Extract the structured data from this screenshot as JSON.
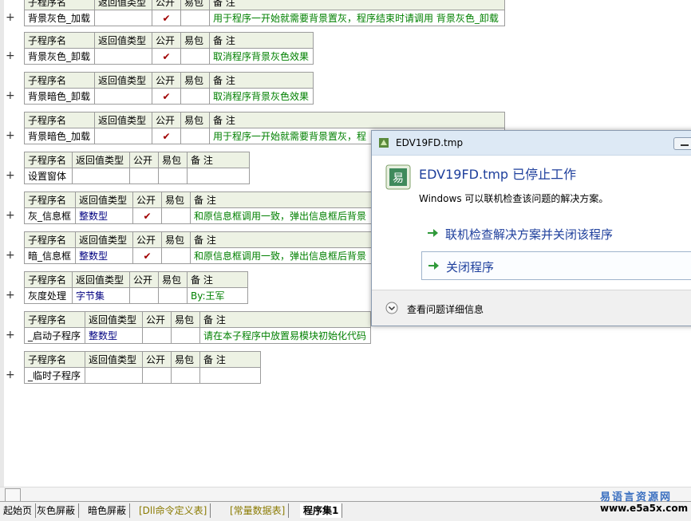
{
  "headers": {
    "name": "子程序名",
    "ret": "返回值类型",
    "pub": "公开",
    "easy": "易包",
    "note": "备 注"
  },
  "checkmark": "✔",
  "plus": "+",
  "subs": [
    {
      "name": "背景灰色_加载",
      "ret": "",
      "pub": "✔",
      "note": "用于程序一开始就需要背景置灰，程序结束时请调用 背景灰色_卸载"
    },
    {
      "name": "背景灰色_卸载",
      "ret": "",
      "pub": "✔",
      "note": "取消程序背景灰色效果"
    },
    {
      "name": "背景暗色_卸载",
      "ret": "",
      "pub": "✔",
      "note": "取消程序背景灰色效果"
    },
    {
      "name": "背景暗色_加载",
      "ret": "",
      "pub": "✔",
      "note": "用于程序一开始就需要背景置灰，程"
    },
    {
      "name": "设置窗体",
      "ret": "",
      "pub": "",
      "note": ""
    },
    {
      "name": "灰_信息框",
      "ret": "整数型",
      "pub": "✔",
      "note": "和原信息框调用一致，弹出信息框后背景"
    },
    {
      "name": "暗_信息框",
      "ret": "整数型",
      "pub": "✔",
      "note": "和原信息框调用一致，弹出信息框后背景"
    },
    {
      "name": "灰度处理",
      "ret": "字节集",
      "pub": "",
      "note": "By:王军"
    },
    {
      "name": "_启动子程序",
      "ret": "整数型",
      "pub": "",
      "note": "请在本子程序中放置易模块初始化代码"
    },
    {
      "name": "_临时子程序",
      "ret": "",
      "pub": "",
      "note": ""
    }
  ],
  "dialog": {
    "title": "EDV19FD.tmp",
    "heading": "EDV19FD.tmp 已停止工作",
    "message": "Windows 可以联机检查该问题的解决方案。",
    "option1": "联机检查解决方案并关闭该程序",
    "option2": "关闭程序",
    "details": "查看问题详细信息"
  },
  "tabs": [
    {
      "label": "起始页",
      "style": "normal"
    },
    {
      "label": "灰色屏蔽",
      "style": "normal"
    },
    {
      "label": "暗色屏蔽",
      "style": "normal"
    },
    {
      "label": "[Dll命令定义表]",
      "style": "yellow"
    },
    {
      "label": "[常量数据表]",
      "style": "yellow"
    },
    {
      "label": "程序集1",
      "style": "active"
    }
  ],
  "site": {
    "name": "易语言资源网",
    "url": "www.e5a5x.com"
  },
  "colors": {
    "header_bg": "#edf2e4",
    "note_text": "#008000",
    "ret_text": "#000080",
    "link_blue": "#1e3f9c"
  }
}
